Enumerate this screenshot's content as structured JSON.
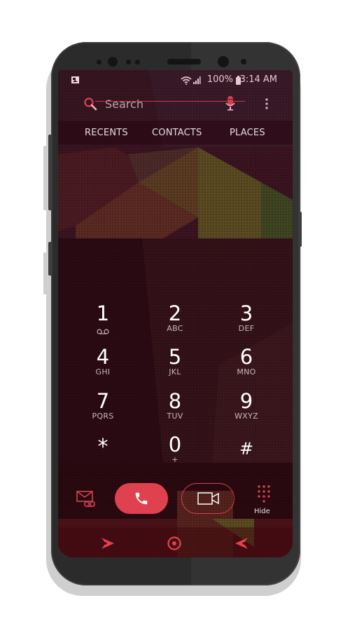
{
  "status_bar": {
    "notification_icon": "image-icon",
    "wifi_icon": "wifi-icon",
    "signal_icon": "signal-icon",
    "battery_percent": "100%",
    "battery_icon": "battery-charging-icon",
    "time": "3:14 AM"
  },
  "search": {
    "placeholder": "Search",
    "search_icon": "search-icon",
    "mic_icon": "microphone-icon",
    "menu_icon": "more-vert-icon"
  },
  "tabs": [
    {
      "label": "RECENTS"
    },
    {
      "label": "CONTACTS"
    },
    {
      "label": "PLACES"
    }
  ],
  "keypad": [
    {
      "digit": "1",
      "letters": "",
      "sub_icon": "voicemail-icon"
    },
    {
      "digit": "2",
      "letters": "ABC"
    },
    {
      "digit": "3",
      "letters": "DEF"
    },
    {
      "digit": "4",
      "letters": "GHI"
    },
    {
      "digit": "5",
      "letters": "JKL"
    },
    {
      "digit": "6",
      "letters": "MNO"
    },
    {
      "digit": "7",
      "letters": "PQRS"
    },
    {
      "digit": "8",
      "letters": "TUV"
    },
    {
      "digit": "9",
      "letters": "WXYZ"
    },
    {
      "digit": "*",
      "letters": ""
    },
    {
      "digit": "0",
      "letters": "+"
    },
    {
      "digit": "#",
      "letters": ""
    }
  ],
  "actions": {
    "voicemail_message_icon": "voicemail-message-icon",
    "call_icon": "phone-icon",
    "video_icon": "video-camera-icon",
    "hide_icon": "dialpad-icon",
    "hide_label": "Hide"
  },
  "navigation": {
    "recent_apps_icon": "recent-apps-icon",
    "home_icon": "home-icon",
    "back_icon": "back-icon"
  },
  "colors": {
    "accent": "#e0414f",
    "background": "#2a0c14"
  }
}
